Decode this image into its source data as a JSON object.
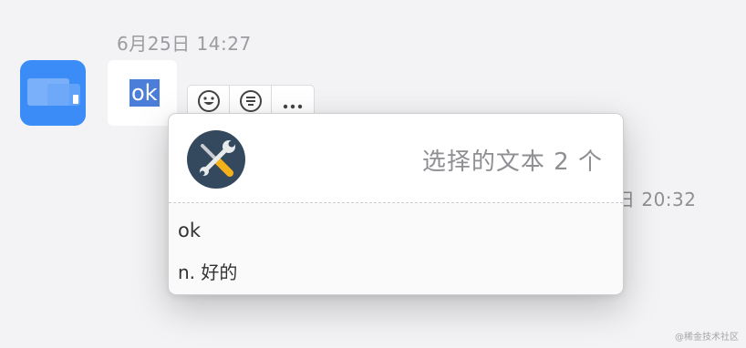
{
  "messages": {
    "first_timestamp": "6月25日 14:27",
    "second_timestamp": "日 20:32",
    "selected_text": "ok"
  },
  "actions": {
    "icons": [
      "smiley-icon",
      "translate-icon",
      "more-icon"
    ]
  },
  "popup": {
    "count_label": "选择的文本 2 个",
    "word": "ok",
    "definition": "n. 好的"
  },
  "watermark": "@稀金技术社区",
  "colors": {
    "background": "#f3f3f5",
    "avatar_blue": "#3b8cf6",
    "selection_blue": "#4a7ed8",
    "tool_icon_bg": "#34495e"
  }
}
